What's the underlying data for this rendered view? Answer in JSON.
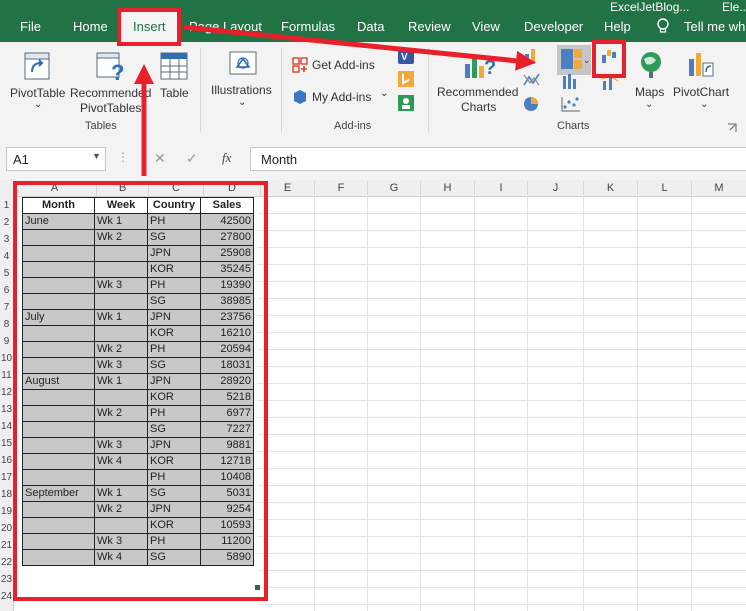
{
  "title_bar": {
    "doc_name": "ExcelJetBlog...",
    "user": "Ele..."
  },
  "tabs": [
    "File",
    "Home",
    "Insert",
    "Page Layout",
    "Formulas",
    "Data",
    "Review",
    "View",
    "Developer",
    "Help",
    "Tell me wha..."
  ],
  "ribbon": {
    "tables": {
      "pivot_table": "PivotTable",
      "recommended_pivot_line1": "Recommended",
      "recommended_pivot_line2": "PivotTables",
      "table": "Table",
      "group": "Tables"
    },
    "illustrations": {
      "label": "Illustrations"
    },
    "addins": {
      "get": "Get Add-ins",
      "my": "My Add-ins",
      "group": "Add-ins"
    },
    "charts": {
      "recommended_line1": "Recommended",
      "recommended_line2": "Charts",
      "maps": "Maps",
      "pivot_chart": "PivotChart",
      "group": "Charts"
    }
  },
  "formula_bar": {
    "name_box": "A1",
    "cancel_symbol": "✕",
    "enter_symbol": "✓",
    "fx_symbol": "fx",
    "value": "Month"
  },
  "columns": [
    "A",
    "B",
    "C",
    "D",
    "E",
    "F",
    "G",
    "H",
    "I",
    "J",
    "K",
    "L",
    "M"
  ],
  "row_numbers": [
    "1",
    "2",
    "3",
    "4",
    "5",
    "6",
    "7",
    "8",
    "9",
    "10",
    "11",
    "12",
    "13",
    "14",
    "15",
    "16",
    "17",
    "18",
    "19",
    "20",
    "21",
    "22",
    "23",
    "24"
  ],
  "table": {
    "headers": [
      "Month",
      "Week",
      "Country",
      "Sales"
    ],
    "rows": [
      [
        "June",
        "Wk 1",
        "PH",
        "42500"
      ],
      [
        "",
        "Wk 2",
        "SG",
        "27800"
      ],
      [
        "",
        "",
        "JPN",
        "25908"
      ],
      [
        "",
        "",
        "KOR",
        "35245"
      ],
      [
        "",
        "Wk 3",
        "PH",
        "19390"
      ],
      [
        "",
        "",
        "SG",
        "38985"
      ],
      [
        "July",
        "Wk 1",
        "JPN",
        "23756"
      ],
      [
        "",
        "",
        "KOR",
        "16210"
      ],
      [
        "",
        "Wk 2",
        "PH",
        "20594"
      ],
      [
        "",
        "Wk 3",
        "SG",
        "18031"
      ],
      [
        "August",
        "Wk 1",
        "JPN",
        "28920"
      ],
      [
        "",
        "",
        "KOR",
        "5218"
      ],
      [
        "",
        "Wk 2",
        "PH",
        "6977"
      ],
      [
        "",
        "",
        "SG",
        "7227"
      ],
      [
        "",
        "Wk 3",
        "JPN",
        "9881"
      ],
      [
        "",
        "Wk 4",
        "KOR",
        "12718"
      ],
      [
        "",
        "",
        "PH",
        "10408"
      ],
      [
        "September",
        "Wk 1",
        "SG",
        "5031"
      ],
      [
        "",
        "Wk 2",
        "JPN",
        "9254"
      ],
      [
        "",
        "",
        "KOR",
        "10593"
      ],
      [
        "",
        "Wk 3",
        "PH",
        "11200"
      ],
      [
        "",
        "Wk 4",
        "SG",
        "5890"
      ]
    ]
  },
  "colors": {
    "excel_green": "#217346",
    "annotation_red": "#e8202a",
    "selection_fill": "#c8c8c8"
  }
}
